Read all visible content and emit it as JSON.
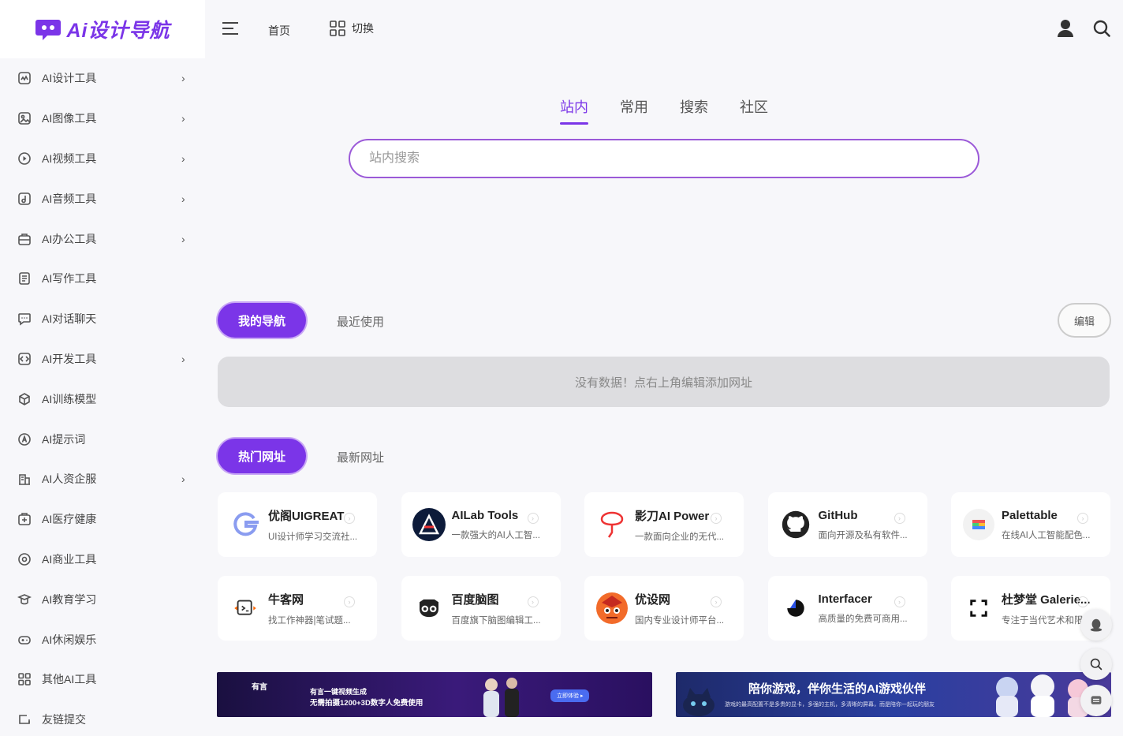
{
  "logo": {
    "text": "Ai设计导航"
  },
  "sidebar": {
    "items": [
      {
        "label": "AI设计工具",
        "icon": "design-icon",
        "has_children": true
      },
      {
        "label": "AI图像工具",
        "icon": "image-icon",
        "has_children": true
      },
      {
        "label": "AI视频工具",
        "icon": "video-icon",
        "has_children": true
      },
      {
        "label": "AI音频工具",
        "icon": "audio-icon",
        "has_children": true
      },
      {
        "label": "AI办公工具",
        "icon": "office-icon",
        "has_children": true
      },
      {
        "label": "AI写作工具",
        "icon": "writing-icon",
        "has_children": false
      },
      {
        "label": "AI对话聊天",
        "icon": "chat-icon",
        "has_children": false
      },
      {
        "label": "AI开发工具",
        "icon": "code-icon",
        "has_children": true
      },
      {
        "label": "AI训练模型",
        "icon": "model-icon",
        "has_children": false
      },
      {
        "label": "AI提示词",
        "icon": "prompt-icon",
        "has_children": false
      },
      {
        "label": "AI人资企服",
        "icon": "hr-icon",
        "has_children": true
      },
      {
        "label": "AI医疗健康",
        "icon": "medical-icon",
        "has_children": false
      },
      {
        "label": "AI商业工具",
        "icon": "business-icon",
        "has_children": false
      },
      {
        "label": "AI教育学习",
        "icon": "education-icon",
        "has_children": false
      },
      {
        "label": "AI休闲娱乐",
        "icon": "gamepad-icon",
        "has_children": false
      },
      {
        "label": "其他AI工具",
        "icon": "grid-icon",
        "has_children": false
      },
      {
        "label": "友链提交",
        "icon": "link-icon",
        "has_children": false
      }
    ]
  },
  "topbar": {
    "home": "首页",
    "switch": "切换"
  },
  "search": {
    "tabs": [
      "站内",
      "常用",
      "搜索",
      "社区"
    ],
    "active_tab": "站内",
    "placeholder": "站内搜索",
    "accent": "#7b35e8"
  },
  "mynav": {
    "tab_active": "我的导航",
    "tab_other": "最近使用",
    "edit": "编辑",
    "empty": "没有数据！点右上角编辑添加网址"
  },
  "hot": {
    "tab_active": "热门网址",
    "tab_other": "最新网址",
    "cards": [
      {
        "name": "优阁UIGREAT",
        "desc": "UI设计师学习交流社...",
        "logo": "uigreat-logo"
      },
      {
        "name": "AILab Tools",
        "desc": "一款强大的AI人工智...",
        "logo": "ailab-logo"
      },
      {
        "name": "影刀AI Power",
        "desc": "一款面向企业的无代...",
        "logo": "yingdao-logo"
      },
      {
        "name": "GitHub",
        "desc": "面向开源及私有软件...",
        "logo": "github-logo"
      },
      {
        "name": "Palettable",
        "desc": "在线AI人工智能配色...",
        "logo": "palettable-logo"
      },
      {
        "name": "牛客网",
        "desc": "找工作神器|笔试题...",
        "logo": "nowcoder-logo"
      },
      {
        "name": "百度脑图",
        "desc": "百度旗下脑图编辑工...",
        "logo": "naotu-logo"
      },
      {
        "name": "优设网",
        "desc": "国内专业设计师平台...",
        "logo": "uisdc-logo"
      },
      {
        "name": "Interfacer",
        "desc": "高质量的免费可商用...",
        "logo": "interfacer-logo"
      },
      {
        "name": "杜梦堂 Galerie...",
        "desc": "专注于当代艺术和限...",
        "logo": "dumengtang-logo"
      }
    ]
  },
  "banners": [
    {
      "line1": "有言一键视频生成",
      "line2": "无需拍摄1200+3D数字人免费使用",
      "cta": "立即体验 ▸",
      "brand": "有言"
    },
    {
      "line1": "陪你游戏，伴你生活的AI游戏伙伴",
      "line2": "游戏的最高配置不是多贵的显卡，多强的主机，多清晰的屏幕，而是陪你一起玩的朋友"
    }
  ]
}
